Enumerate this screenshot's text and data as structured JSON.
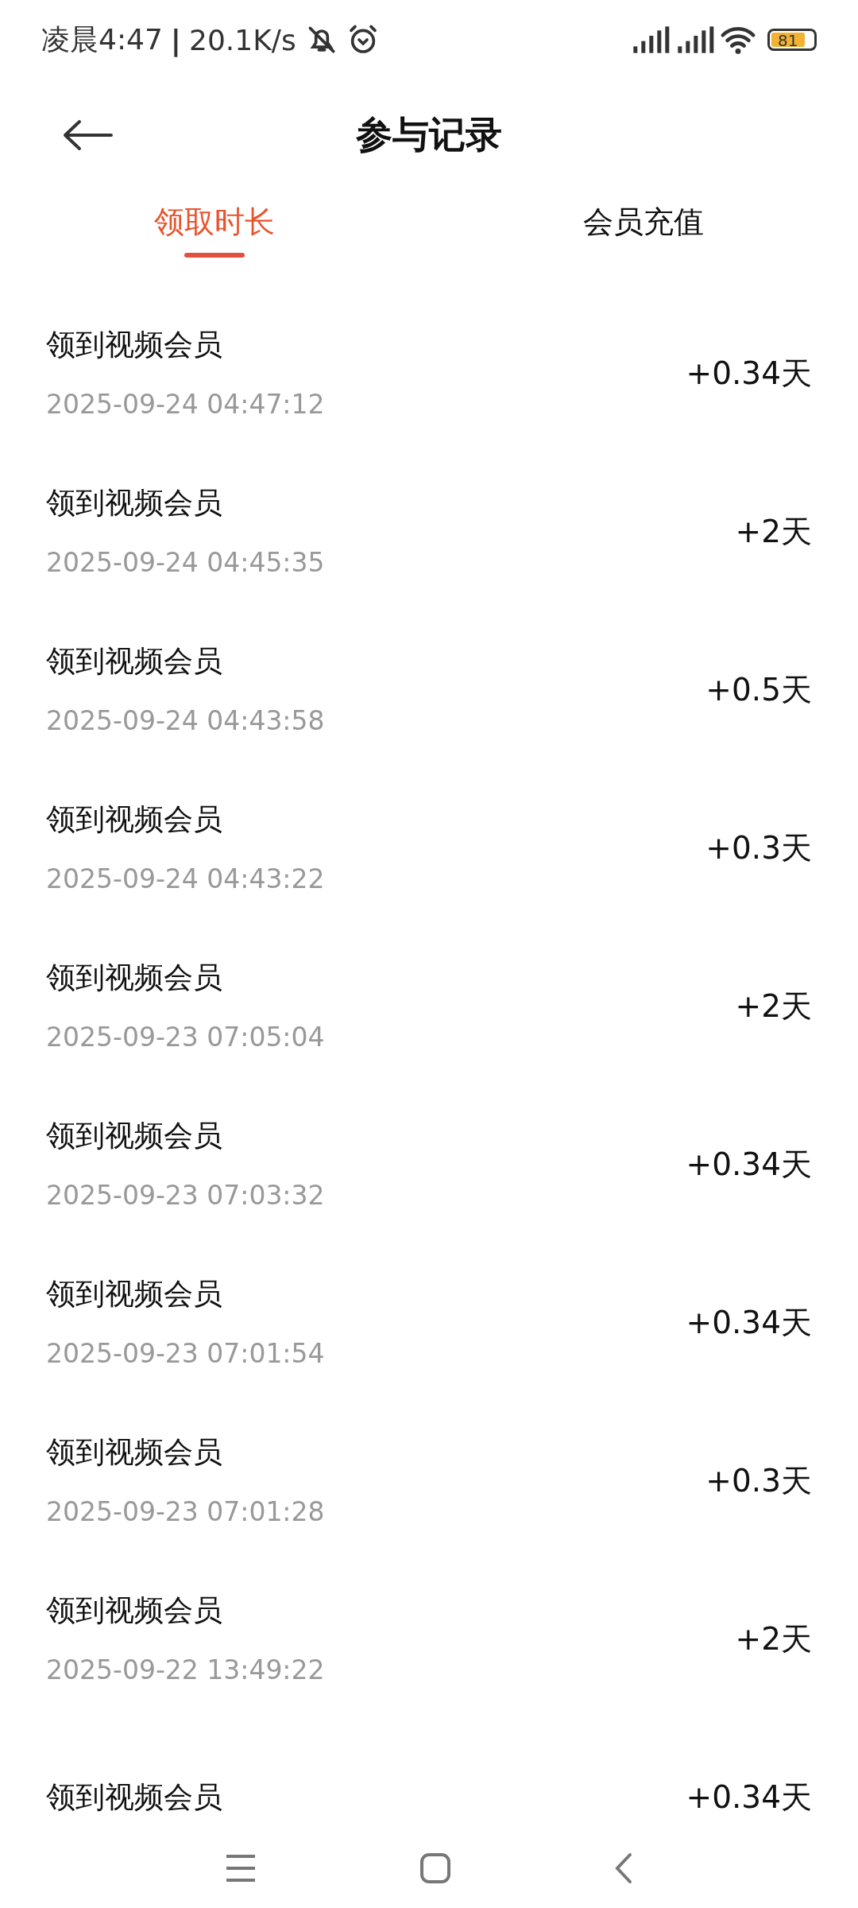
{
  "status_bar": {
    "time": "凌晨4:47",
    "separator": "|",
    "speed": "20.1K/s",
    "battery": "81"
  },
  "header": {
    "title": "参与记录"
  },
  "tabs": [
    {
      "label": "领取时长",
      "selected": true
    },
    {
      "label": "会员充值",
      "selected": false
    }
  ],
  "records": [
    {
      "title": "领到视频会员",
      "time": "2025-09-24 04:47:12",
      "amount": "+0.34天"
    },
    {
      "title": "领到视频会员",
      "time": "2025-09-24 04:45:35",
      "amount": "+2天"
    },
    {
      "title": "领到视频会员",
      "time": "2025-09-24 04:43:58",
      "amount": "+0.5天"
    },
    {
      "title": "领到视频会员",
      "time": "2025-09-24 04:43:22",
      "amount": "+0.3天"
    },
    {
      "title": "领到视频会员",
      "time": "2025-09-23 07:05:04",
      "amount": "+2天"
    },
    {
      "title": "领到视频会员",
      "time": "2025-09-23 07:03:32",
      "amount": "+0.34天"
    },
    {
      "title": "领到视频会员",
      "time": "2025-09-23 07:01:54",
      "amount": "+0.34天"
    },
    {
      "title": "领到视频会员",
      "time": "2025-09-23 07:01:28",
      "amount": "+0.3天"
    },
    {
      "title": "领到视频会员",
      "time": "2025-09-22 13:49:22",
      "amount": "+2天"
    },
    {
      "title": "领到视频会员",
      "amount": "+0.34天"
    }
  ]
}
